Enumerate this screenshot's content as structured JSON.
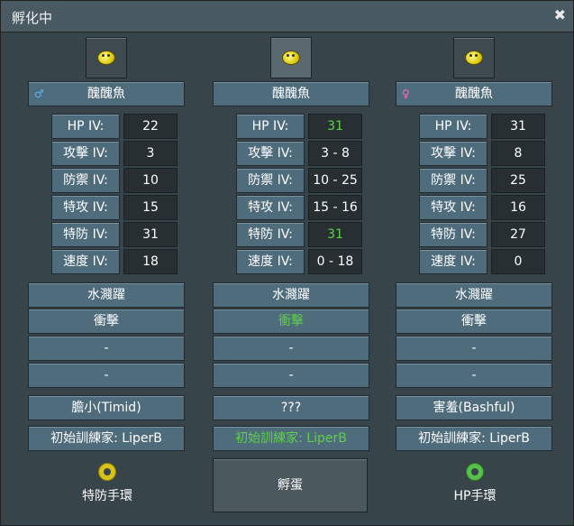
{
  "window": {
    "title": "孵化中",
    "close_glyph": "✖"
  },
  "columns": [
    {
      "name": "醜醜魚",
      "gender_symbol": "♂",
      "gender_color": "#56b8ff",
      "iv": [
        {
          "label": "HP IV:",
          "value": "22"
        },
        {
          "label": "攻擊 IV:",
          "value": "3"
        },
        {
          "label": "防禦 IV:",
          "value": "10"
        },
        {
          "label": "特攻 IV:",
          "value": "15"
        },
        {
          "label": "特防 IV:",
          "value": "31"
        },
        {
          "label": "速度 IV:",
          "value": "18"
        }
      ],
      "moves": [
        "水濺躍",
        "衝擊",
        "-",
        "-"
      ],
      "nature": "膽小(Timid)",
      "trainer": "初始訓練家: LiperB",
      "held_item": "特防手環"
    },
    {
      "name": "醜醜魚",
      "gender_symbol": "",
      "iv": [
        {
          "label": "HP IV:",
          "value": "31"
        },
        {
          "label": "攻擊 IV:",
          "value": "3 - 8"
        },
        {
          "label": "防禦 IV:",
          "value": "10 - 25"
        },
        {
          "label": "特攻 IV:",
          "value": "15 - 16"
        },
        {
          "label": "特防 IV:",
          "value": "31"
        },
        {
          "label": "速度 IV:",
          "value": "0 - 18"
        }
      ],
      "moves": [
        "水濺躍",
        "衝擊",
        "-",
        "-"
      ],
      "nature": "???",
      "trainer": "初始訓練家: LiperB",
      "hatch_button": "孵蛋"
    },
    {
      "name": "醜醜魚",
      "gender_symbol": "♀",
      "gender_color": "#ff6ab5",
      "iv": [
        {
          "label": "HP IV:",
          "value": "31"
        },
        {
          "label": "攻擊 IV:",
          "value": "8"
        },
        {
          "label": "防禦 IV:",
          "value": "25"
        },
        {
          "label": "特攻 IV:",
          "value": "16"
        },
        {
          "label": "特防 IV:",
          "value": "27"
        },
        {
          "label": "速度 IV:",
          "value": "0"
        }
      ],
      "moves": [
        "水濺躍",
        "衝擊",
        "-",
        "-"
      ],
      "nature": "害羞(Bashful)",
      "trainer": "初始訓練家: LiperB",
      "held_item": "HP手環"
    }
  ],
  "colors": {
    "highlight_green": "#5fd04a"
  }
}
